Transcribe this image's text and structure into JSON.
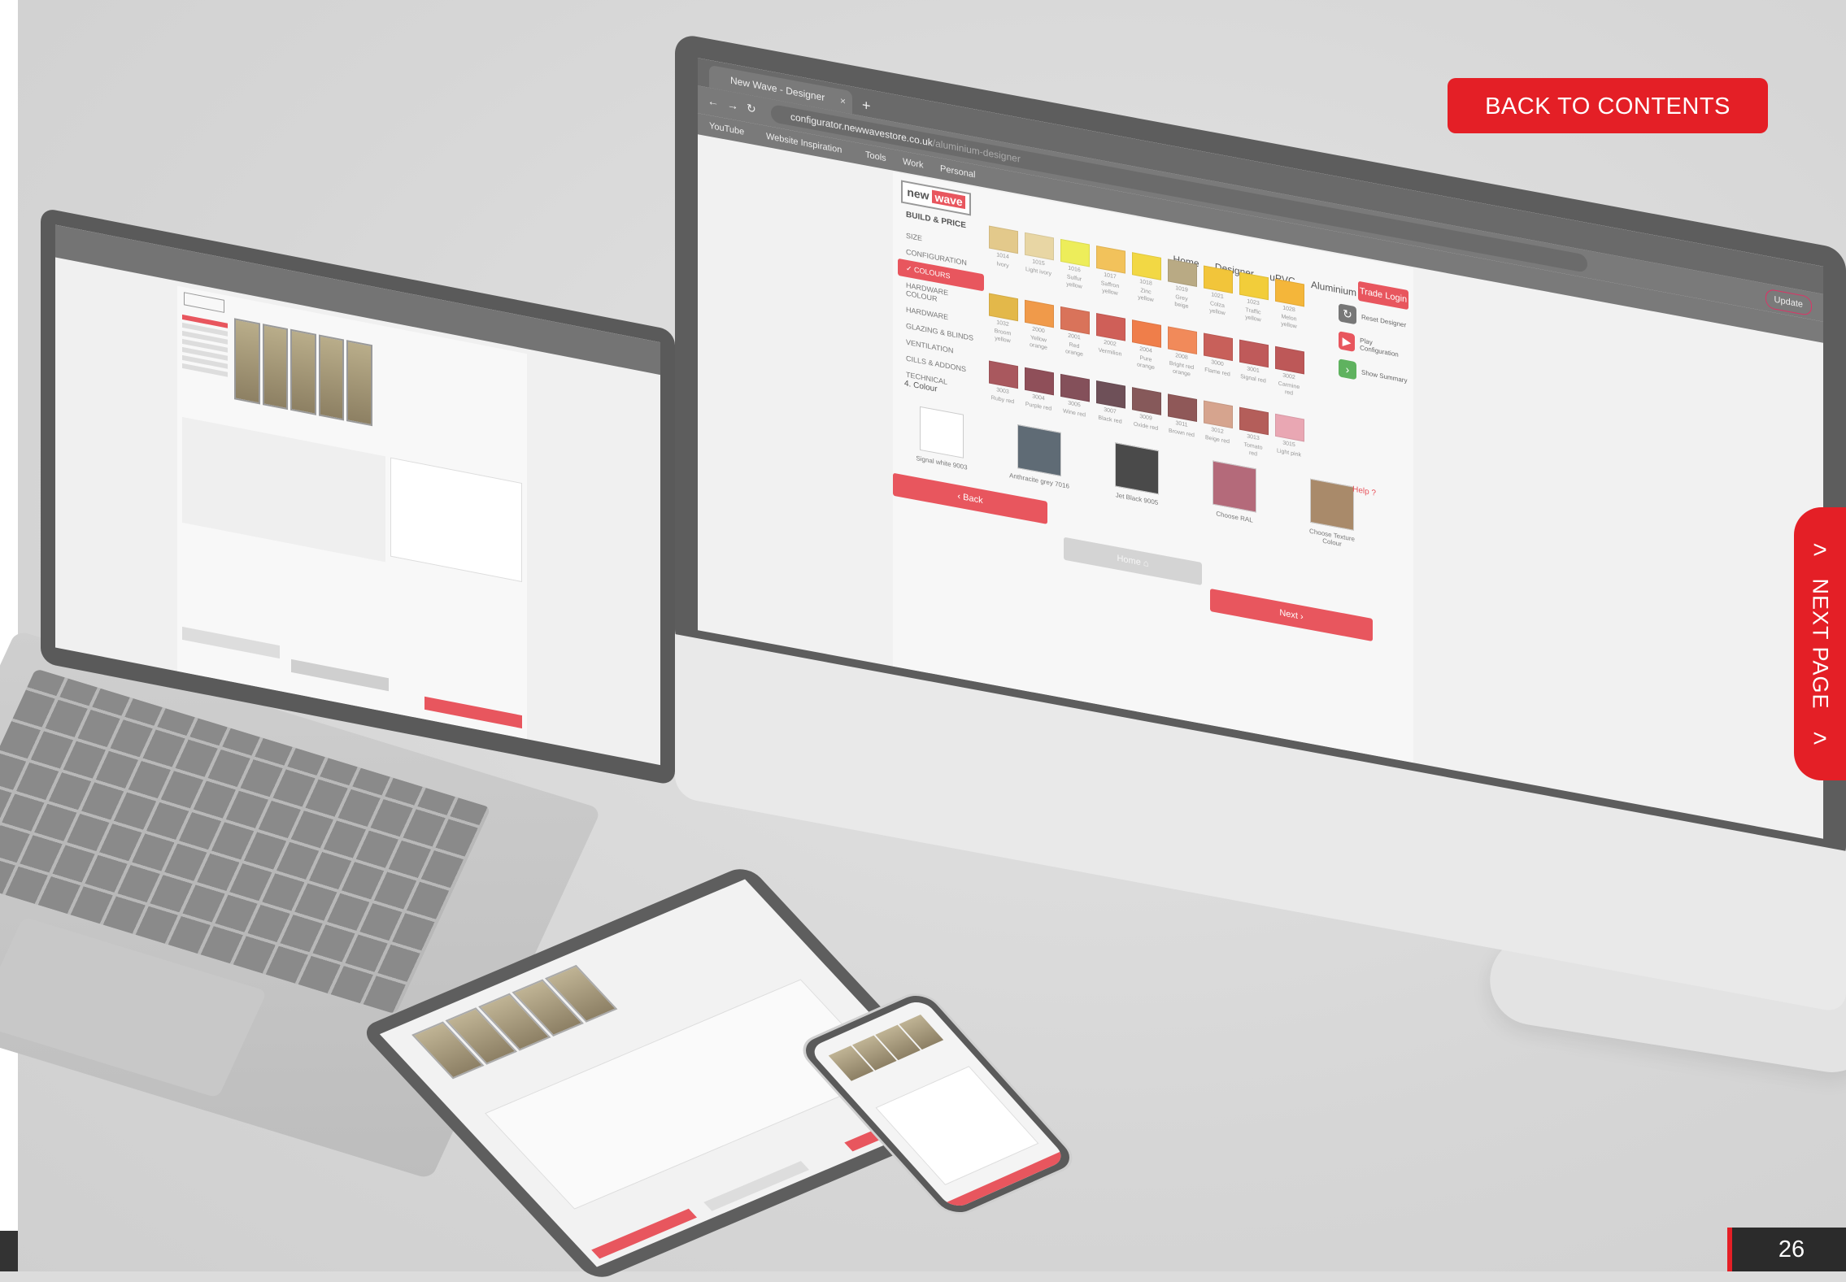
{
  "overlay": {
    "back_to_contents_label": "BACK TO CONTENTS",
    "next_page_label": "NEXT PAGE",
    "next_page_chevron": ">",
    "page_number": "26"
  },
  "colors": {
    "accent_red": "#e41f26",
    "site_red": "#e8565e",
    "footer_dark": "#2b2b2b"
  },
  "desktop": {
    "browser": {
      "tab_title": "New Wave - Designer",
      "tab_close": "×",
      "new_tab": "+",
      "url_host": "configurator.newwavestore.co.uk",
      "url_path": "/aluminium-designer",
      "update_label": "Update",
      "bookmarks": [
        "YouTube",
        "Website Inspiration",
        "Tools",
        "Work",
        "Personal"
      ]
    },
    "site": {
      "logo_new": "new",
      "logo_wave": "wave",
      "nav": [
        "Home",
        "Designer",
        "uPVC",
        "Aluminium"
      ],
      "trade_login": "Trade Login",
      "side_title": "BUILD & PRICE",
      "side_items": [
        "SIZE",
        "CONFIGURATION",
        "COLOURS",
        "HARDWARE COLOUR",
        "HARDWARE",
        "GLAZING & BLINDS",
        "VENTILATION",
        "CILLS & ADDONS",
        "TECHNICAL"
      ],
      "active_item": "✓ COLOURS",
      "swatch_rows": [
        [
          {
            "code": "1014",
            "name": "Ivory",
            "color": "#e3c98b"
          },
          {
            "code": "1015",
            "name": "Light ivory",
            "color": "#e8d6a4"
          },
          {
            "code": "1016",
            "name": "Sulfur yellow",
            "color": "#eded5a"
          },
          {
            "code": "1017",
            "name": "Saffron yellow",
            "color": "#f2c25b"
          },
          {
            "code": "1018",
            "name": "Zinc yellow",
            "color": "#f2d844"
          },
          {
            "code": "1019",
            "name": "Grey beige",
            "color": "#b9aa84"
          },
          {
            "code": "1021",
            "name": "Colza yellow",
            "color": "#f2c53a"
          },
          {
            "code": "1023",
            "name": "Traffic yellow",
            "color": "#f2cd3a"
          },
          {
            "code": "1028",
            "name": "Melon yellow",
            "color": "#f4b63a"
          }
        ],
        [
          {
            "code": "1032",
            "name": "Broom yellow",
            "color": "#e3b84a"
          },
          {
            "code": "2000",
            "name": "Yellow orange",
            "color": "#f09a4a"
          },
          {
            "code": "2001",
            "name": "Red orange",
            "color": "#d9735a"
          },
          {
            "code": "2002",
            "name": "Vermilion",
            "color": "#cf5f58"
          },
          {
            "code": "2004",
            "name": "Pure orange",
            "color": "#ef7e4a"
          },
          {
            "code": "2008",
            "name": "Bright red orange",
            "color": "#f18a5a"
          },
          {
            "code": "3000",
            "name": "Flame red",
            "color": "#c8605a"
          },
          {
            "code": "3001",
            "name": "Signal red",
            "color": "#bf5a5a"
          },
          {
            "code": "3002",
            "name": "Carmine red",
            "color": "#bd5858"
          }
        ],
        [
          {
            "code": "3003",
            "name": "Ruby red",
            "color": "#a9585e"
          },
          {
            "code": "3004",
            "name": "Purple red",
            "color": "#8f4f59"
          },
          {
            "code": "3005",
            "name": "Wine red",
            "color": "#84505a"
          },
          {
            "code": "3007",
            "name": "Black red",
            "color": "#6e5058"
          },
          {
            "code": "3009",
            "name": "Oxide red",
            "color": "#86595a"
          },
          {
            "code": "3011",
            "name": "Brown red",
            "color": "#8f5858"
          },
          {
            "code": "3012",
            "name": "Beige red",
            "color": "#d6a48e"
          },
          {
            "code": "3013",
            "name": "Tomato red",
            "color": "#b45e5a"
          },
          {
            "code": "3015",
            "name": "Light pink",
            "color": "#e9a7b3"
          }
        ]
      ],
      "actions": [
        {
          "label": "Reset Designer",
          "glyph": "↻",
          "color": "#777777"
        },
        {
          "label": "Play Configuration",
          "glyph": "▶",
          "color": "#e8565e"
        },
        {
          "label": "Show Summary",
          "glyph": "›",
          "color": "#5fb25f"
        }
      ],
      "colour_section_title": "4. Colour",
      "colour_options": [
        {
          "label": "Signal white 9003",
          "color": "#ffffff"
        },
        {
          "label": "Anthracite grey 7016",
          "color": "#5f6b75"
        },
        {
          "label": "Jet Black 9005",
          "color": "#4a4a4a"
        },
        {
          "label": "Choose RAL",
          "color": "#b46a7a"
        },
        {
          "label": "Choose Texture Colour",
          "color": "#a98a6a"
        }
      ],
      "help_label": "Help ?",
      "back_label": "‹   Back",
      "home_label": "Home ⌂",
      "next_label": "Next   ›"
    }
  }
}
